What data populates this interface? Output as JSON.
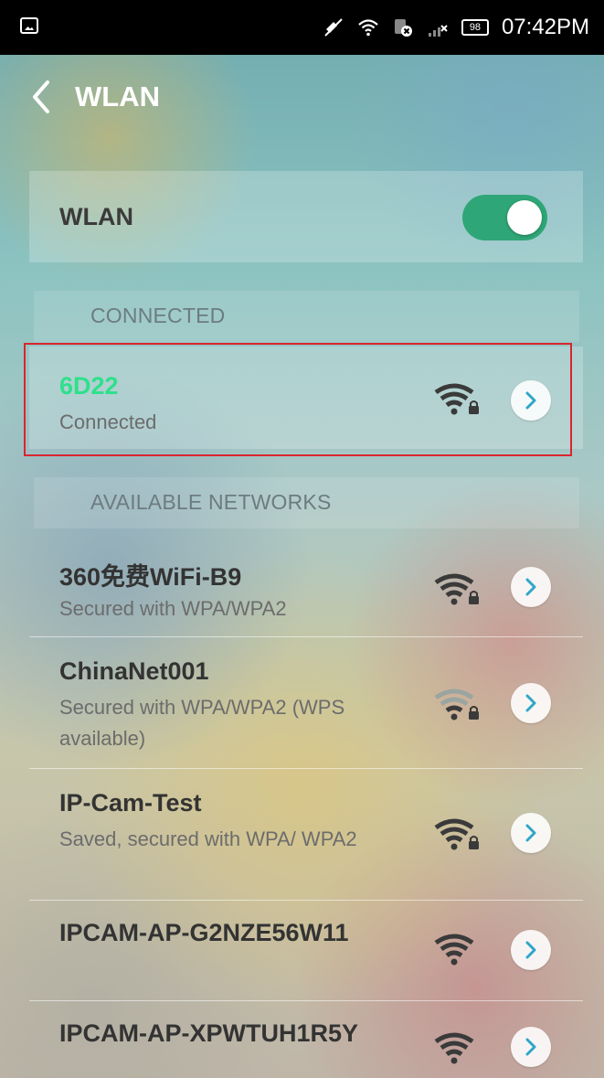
{
  "status_bar": {
    "time": "07:42PM",
    "battery": "98",
    "icons": [
      "picture-icon",
      "mute-icon",
      "wifi-icon",
      "sim-error-icon",
      "signal-icon",
      "battery-icon"
    ]
  },
  "header": {
    "title": "WLAN",
    "back_icon": "chevron-left-icon"
  },
  "wlan_toggle": {
    "label": "WLAN",
    "enabled": true,
    "accent_color": "#2fa677"
  },
  "connected_section": {
    "header": "CONNECTED",
    "network": {
      "name": "6D22",
      "status": "Connected",
      "name_color": "#2fe08c",
      "secured": true
    }
  },
  "available_section": {
    "header": "AVAILABLE NETWORKS",
    "networks": [
      {
        "name": "360免费WiFi-B9",
        "status": "Secured with WPA/WPA2",
        "secured": true,
        "signal": "strong"
      },
      {
        "name": "ChinaNet001",
        "status": "Secured with WPA/WPA2 (WPS available)",
        "secured": true,
        "signal": "weak"
      },
      {
        "name": "IP-Cam-Test",
        "status": "Saved, secured with WPA/ WPA2",
        "secured": true,
        "signal": "strong"
      },
      {
        "name": "IPCAM-AP-G2NZE56W11",
        "status": "",
        "secured": false,
        "signal": "strong"
      },
      {
        "name": "IPCAM-AP-XPWTUH1R5Y",
        "status": "",
        "secured": false,
        "signal": "strong"
      }
    ]
  }
}
